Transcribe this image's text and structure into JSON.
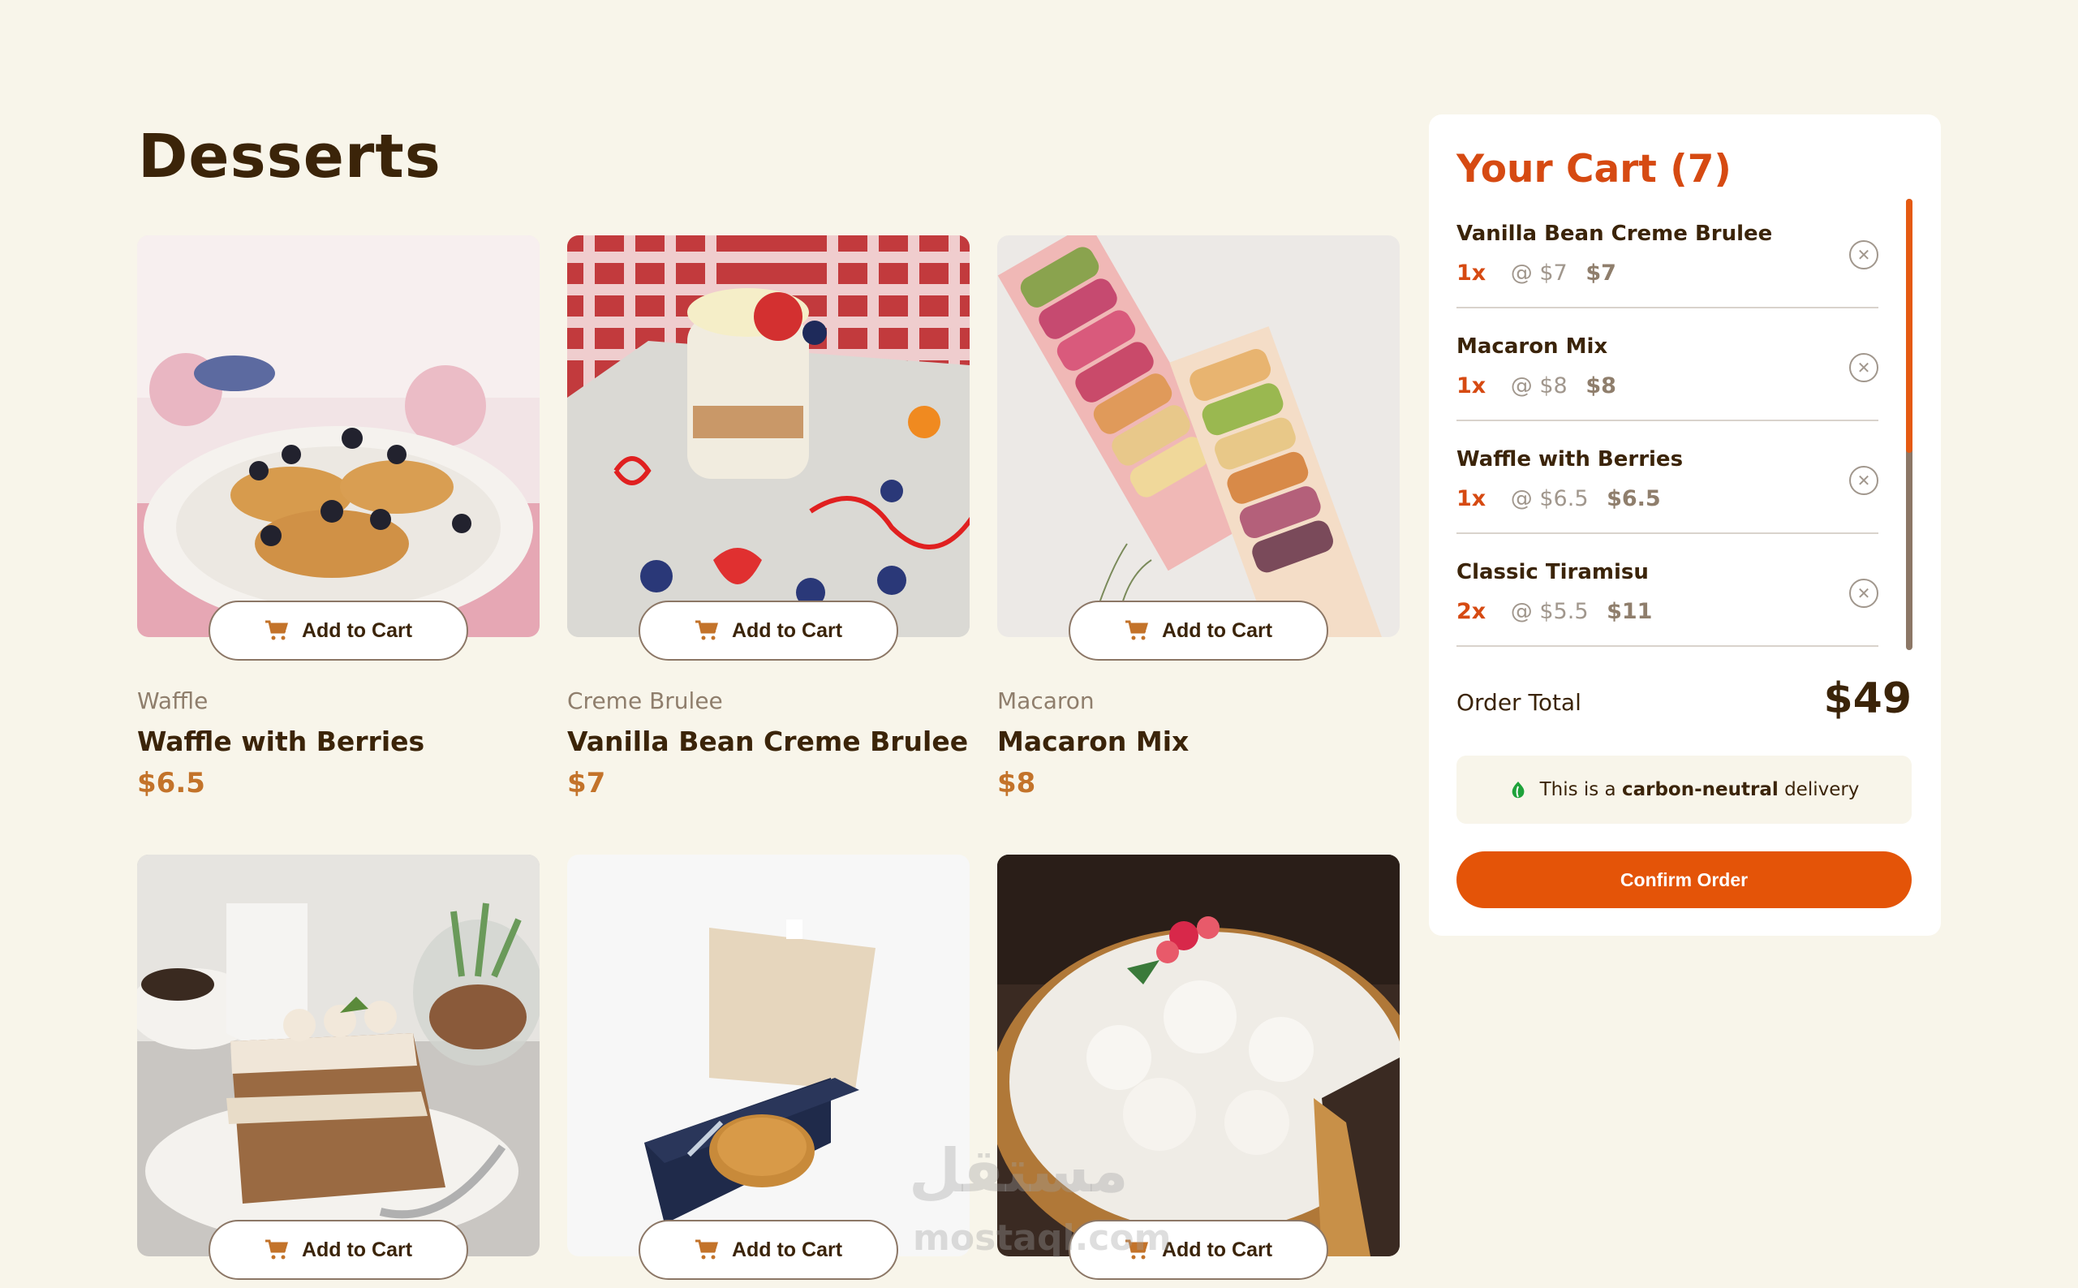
{
  "page": {
    "title": "Desserts"
  },
  "products": [
    {
      "category": "Waffle",
      "name": "Waffle with Berries",
      "price": "$6.5",
      "add_label": "Add to Cart",
      "image": "waffle-image"
    },
    {
      "category": "Creme Brulee",
      "name": "Vanilla Bean Creme Brulee",
      "price": "$7",
      "add_label": "Add to Cart",
      "image": "creme-brulee-image"
    },
    {
      "category": "Macaron",
      "name": "Macaron Mix",
      "price": "$8",
      "add_label": "Add to Cart",
      "image": "macaron-image"
    },
    {
      "category": "",
      "name": "",
      "price": "",
      "add_label": "Add to Cart",
      "image": "tiramisu-image"
    },
    {
      "category": "",
      "name": "",
      "price": "",
      "add_label": "Add to Cart",
      "image": "baklava-box-image"
    },
    {
      "category": "",
      "name": "",
      "price": "",
      "add_label": "Add to Cart",
      "image": "meringue-pie-image"
    }
  ],
  "cart": {
    "title": "Your Cart (7)",
    "items": [
      {
        "name": "Vanilla Bean Creme Brulee",
        "qty": "1x",
        "each": "@ $7",
        "total": "$7"
      },
      {
        "name": "Macaron Mix",
        "qty": "1x",
        "each": "@ $8",
        "total": "$8"
      },
      {
        "name": "Waffle with Berries",
        "qty": "1x",
        "each": "@ $6.5",
        "total": "$6.5"
      },
      {
        "name": "Classic Tiramisu",
        "qty": "2x",
        "each": "@ $5.5",
        "total": "$11"
      }
    ],
    "order_total_label": "Order Total",
    "order_total_value": "$49",
    "carbon_prefix": "This is a",
    "carbon_bold": "carbon-neutral",
    "carbon_suffix": "delivery",
    "confirm_label": "Confirm Order"
  },
  "watermark": {
    "text": "مستقل",
    "sub": "mostaql.com"
  },
  "colors": {
    "accent": "#e45408",
    "background": "#f8f5ea",
    "price": "#c3732a",
    "title": "#3b2409"
  }
}
